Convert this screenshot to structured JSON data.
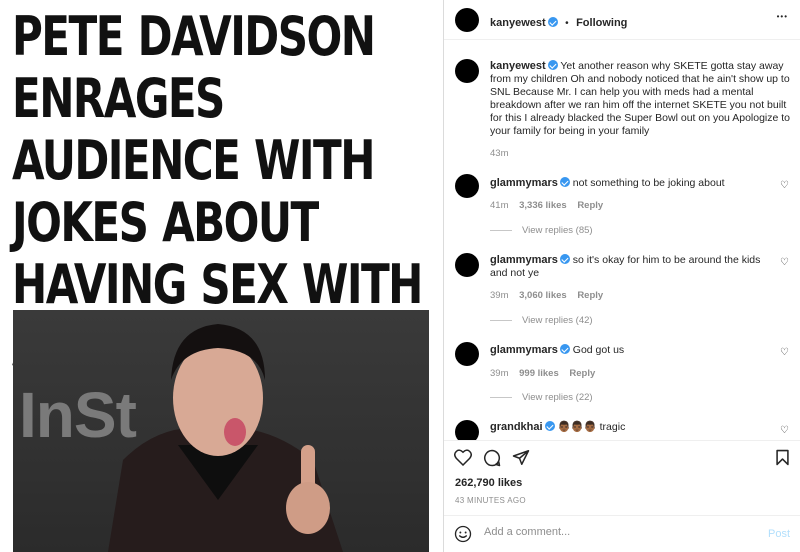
{
  "article": {
    "headline": "PETE DAVIDSON ENRAGES AUDIENCE WITH JOKES ABOUT HAVING SEX WITH A BABY",
    "photo_brand": "InSt"
  },
  "post": {
    "author": "kanyewest",
    "follow_separator": "•",
    "follow_status": "Following",
    "more_label": "•••",
    "caption": {
      "username": "kanyewest",
      "text": "Yet another reason why SKETE gotta stay away from my children Oh and nobody noticed that he ain't show up to SNL Because Mr. I can help you with meds had a mental breakdown after we ran him off the internet SKETE you not built for this I already blacked the Super Bowl out on you Apologize to your family for being in your family",
      "time": "43m"
    },
    "comments": [
      {
        "username": "glammymars",
        "text": "not something to be joking about",
        "time": "41m",
        "likes": "3,336 likes",
        "reply": "Reply",
        "view_replies": "View replies (85)"
      },
      {
        "username": "glammymars",
        "text": "so it's okay for him to be around the kids and not ye",
        "time": "39m",
        "likes": "3,060 likes",
        "reply": "Reply",
        "view_replies": "View replies (42)"
      },
      {
        "username": "glammymars",
        "text": "God got us",
        "time": "39m",
        "likes": "999 likes",
        "reply": "Reply",
        "view_replies": "View replies (22)"
      },
      {
        "username": "grandkhai",
        "text": "👨🏾👨🏾👨🏾 tragic"
      }
    ],
    "like_count": "262,790 likes",
    "posted_ago": "43 MINUTES AGO",
    "comment_placeholder": "Add a comment...",
    "post_label": "Post",
    "icons": [
      "heart-icon",
      "comment-icon",
      "share-icon",
      "bookmark-icon",
      "emoji-icon"
    ]
  }
}
